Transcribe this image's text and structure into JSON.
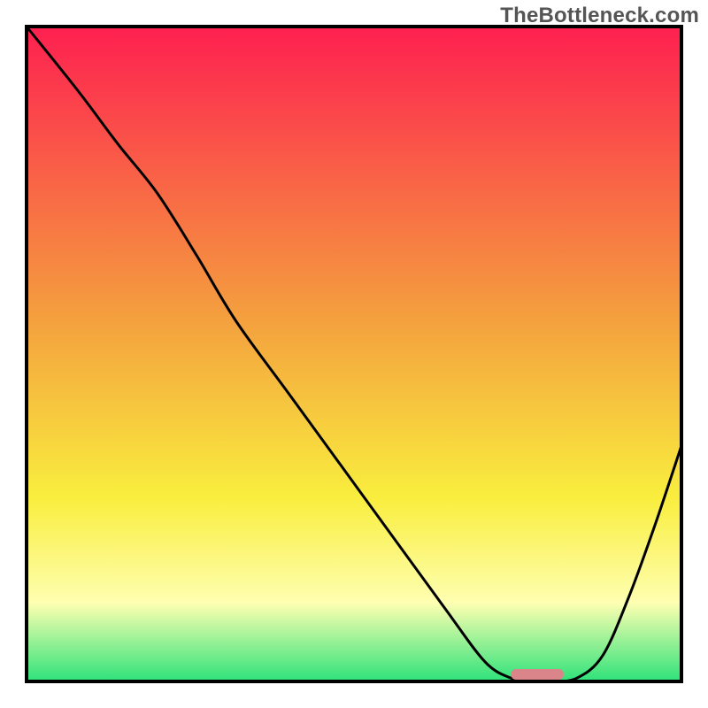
{
  "watermark": "TheBottleneck.com",
  "colors": {
    "gradient_top": "#fe2050",
    "gradient_mid1": "#f4a13e",
    "gradient_mid2": "#f9ee3e",
    "gradient_mid3": "#feffb1",
    "gradient_bottom": "#2ee27a",
    "border": "#000000",
    "curve": "#000000",
    "marker": "#d98589"
  },
  "chart_data": {
    "type": "line",
    "title": "",
    "xlabel": "",
    "ylabel": "",
    "xlim": [
      0,
      100
    ],
    "ylim": [
      0,
      100
    ],
    "x": [
      0,
      8,
      14,
      20,
      26,
      32,
      40,
      48,
      56,
      64,
      70,
      74,
      77,
      80,
      84,
      88,
      92,
      96,
      100
    ],
    "values": [
      100,
      90,
      82,
      74.5,
      65,
      55,
      44,
      33,
      22,
      11,
      3,
      0.5,
      0,
      0,
      0.5,
      4,
      13,
      24,
      36
    ],
    "marker": {
      "x_start": 74,
      "x_end": 82,
      "y": 0
    },
    "annotations": []
  }
}
